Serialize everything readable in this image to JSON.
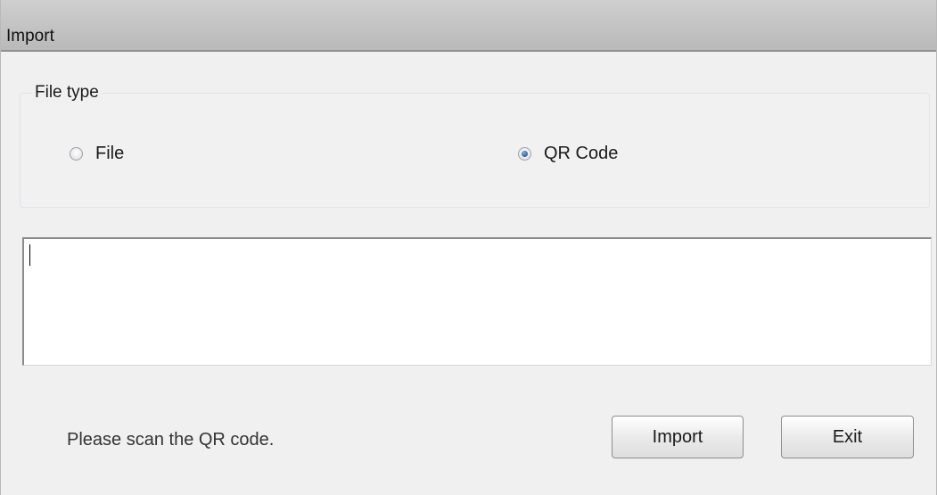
{
  "window": {
    "title": "Import"
  },
  "file_type_group": {
    "legend": "File type",
    "options": [
      {
        "label": "File",
        "checked": false
      },
      {
        "label": "QR Code",
        "checked": true
      }
    ]
  },
  "input": {
    "value": ""
  },
  "footer": {
    "status": "Please scan the QR code.",
    "import_label": "Import",
    "exit_label": "Exit"
  },
  "colors": {
    "titlebar": "#c4c4c4",
    "background": "#f0f0f0",
    "radio_checked": "#2b5f9a"
  }
}
